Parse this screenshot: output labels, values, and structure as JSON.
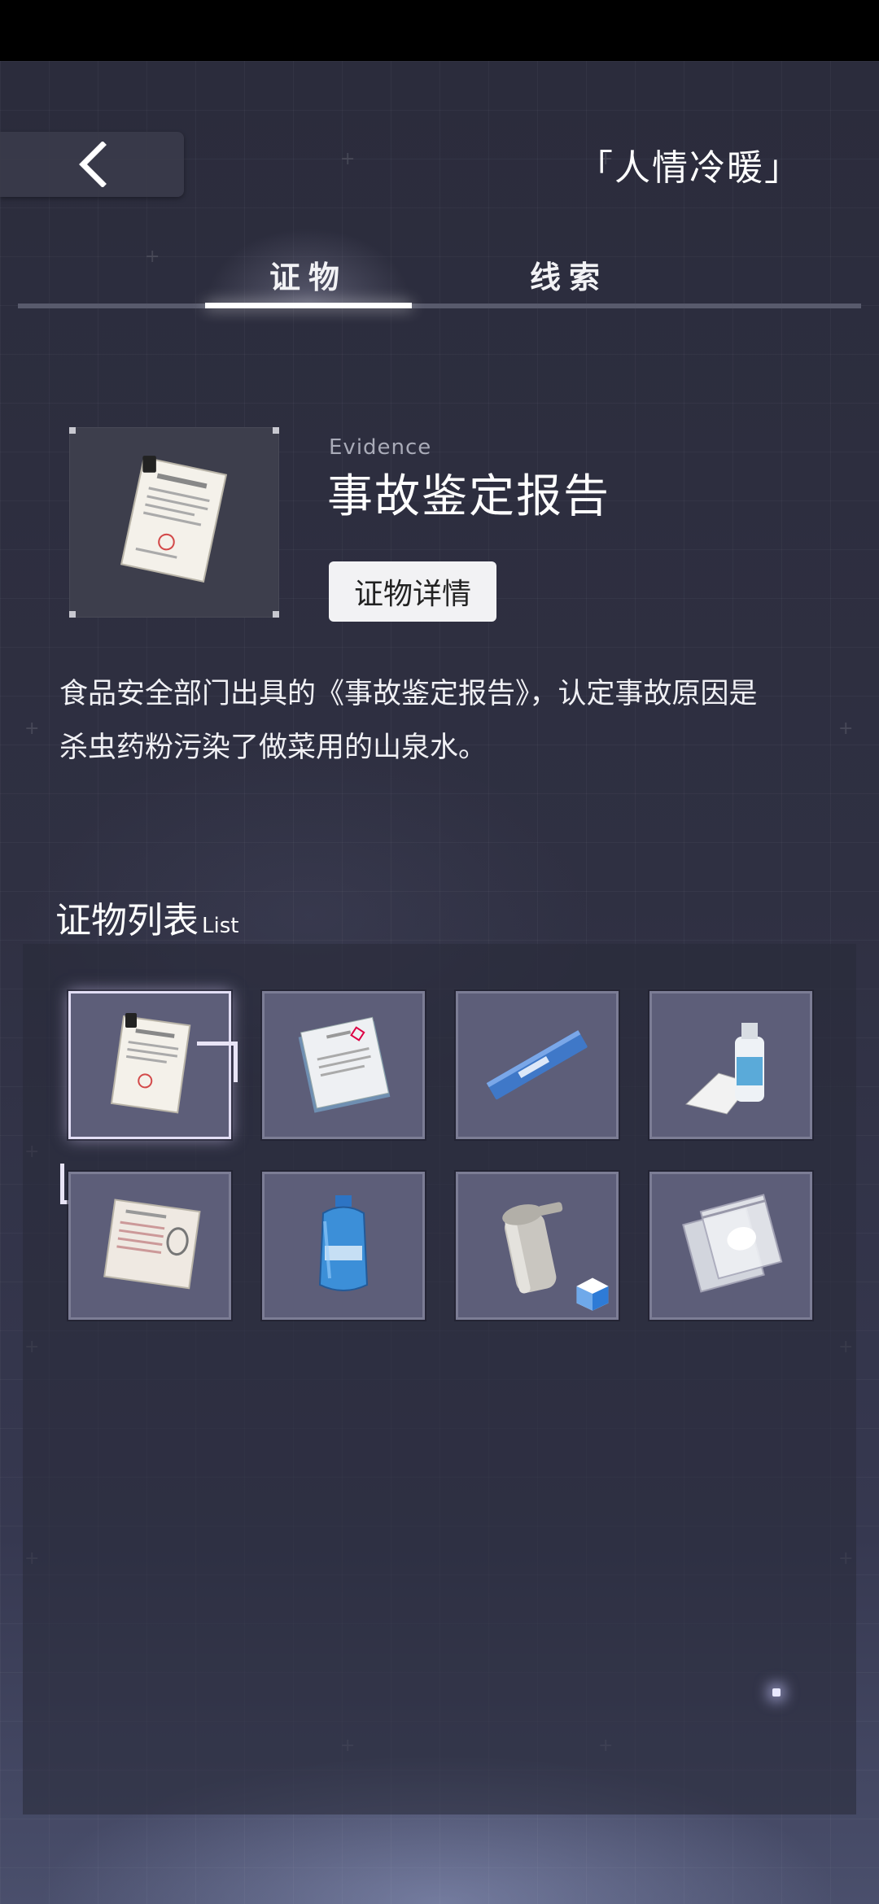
{
  "header": {
    "back_icon": "chevron-left-icon",
    "chapter_title": "「人情冷暖」"
  },
  "tabs": [
    {
      "label": "证物",
      "active": true
    },
    {
      "label": "线索",
      "active": false
    }
  ],
  "selected_evidence": {
    "label": "Evidence",
    "name": "事故鉴定报告",
    "detail_button": "证物详情",
    "description_line1": "食品安全部门出具的《事故鉴定报告》，认定事故原因是",
    "description_line2": "杀虫药粉污染了做菜用的山泉水。",
    "icon": "report-document-icon"
  },
  "evidence_list": {
    "title": "证物列表",
    "subtitle": "List",
    "items": [
      {
        "icon": "accident-report-icon",
        "selected": true
      },
      {
        "icon": "booklet-icon",
        "selected": false
      },
      {
        "icon": "powder-stick-packet-icon",
        "selected": false
      },
      {
        "icon": "bottle-and-receipt-icon",
        "selected": false
      },
      {
        "icon": "fingerprint-record-icon",
        "selected": false
      },
      {
        "icon": "water-jug-icon",
        "selected": false
      },
      {
        "icon": "water-dispenser-part-icon",
        "selected": false,
        "badge": "3d-cube-icon"
      },
      {
        "icon": "powder-bag-icon",
        "selected": false
      }
    ]
  },
  "colors": {
    "background": "#2f3042",
    "slot": "#5d5e79",
    "slot_border": "#7c7d95",
    "accent_white": "#ffffff"
  }
}
